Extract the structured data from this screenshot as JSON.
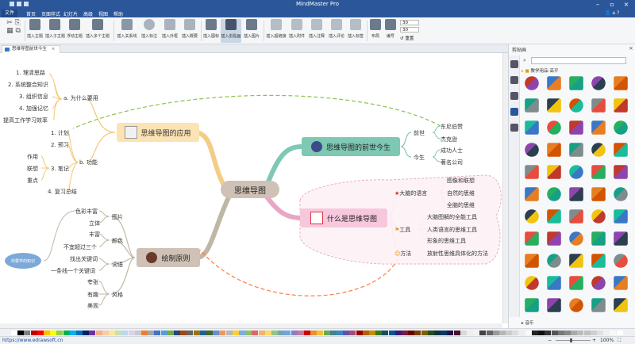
{
  "window": {
    "title": "MindMaster Pro"
  },
  "menu": {
    "file": "文件",
    "items": [
      "首页",
      "页面样式",
      "幻灯片",
      "高级",
      "视图",
      "帮助"
    ]
  },
  "ribbon": {
    "insert": [
      "插入主题",
      "插入子主题",
      "浮动主题",
      "插入多个主题"
    ],
    "relation": [
      "插入关系线",
      "插入标注",
      "插入外框",
      "插入概要"
    ],
    "media": [
      "插入图标",
      "插入剪贴画",
      "插入图片"
    ],
    "more": [
      "插入超链接",
      "插入附件",
      "插入注释",
      "插入评论",
      "插入标签"
    ],
    "layout": [
      "布局",
      "编号"
    ],
    "spacing": {
      "a": "30",
      "b": "30",
      "reset": "重置"
    }
  },
  "doc_tab": {
    "label": "思维导图前世今生"
  },
  "map": {
    "central": "思维导图",
    "branches": {
      "app": "思维导图的应用",
      "history": "思维导图的前世今生",
      "what": "什么是思维导图",
      "rules": "绘制原则"
    },
    "app_sub": {
      "why": "a. 为什么要用",
      "why_items": [
        "1. 理清思路",
        "2. 系统整合知识",
        "3. 组织信息",
        "4. 加强记忆",
        "提高工作学习效率"
      ],
      "func": "b. 功能",
      "func_items": [
        "1. 计划",
        "2. 预习",
        "3. 笔记",
        "4. 复习总结"
      ],
      "notes": [
        "作用",
        "联想",
        "重点"
      ]
    },
    "history_sub": {
      "before": "前世",
      "before_items": [
        "东尼伯赞",
        "杰克逊"
      ],
      "now": "今生",
      "now_items": [
        "成功人士",
        "著名公司"
      ]
    },
    "what_sub": {
      "lang": "大脑的语言",
      "lang_items": [
        "图像和联想",
        "自然的思维",
        "全脑的思维"
      ],
      "tool": "工具",
      "tool_items": [
        "大脑图解的全能工具",
        "人类语言的思维工具",
        "形象的思维工具"
      ],
      "method": "方法",
      "method_item": "放射性思维具体化的方法"
    },
    "rules_sub": {
      "pic": "图片",
      "pic_items": [
        "色彩丰富",
        "立体"
      ],
      "color": "颜色",
      "color_items": [
        "丰富",
        "不宜超过三个"
      ],
      "word": "词语",
      "word_items": [
        "找出关键词",
        "一条线一个关键词"
      ],
      "style": "风格",
      "style_items": [
        "夸张",
        "有趣",
        "美观"
      ],
      "float": "你要学的知识"
    }
  },
  "panel": {
    "title": "剪贴画",
    "library": "教学用品-高平",
    "footer": "音乐"
  },
  "status": {
    "link": "https://www.edrawsoft.cn",
    "zoom": "100%"
  }
}
